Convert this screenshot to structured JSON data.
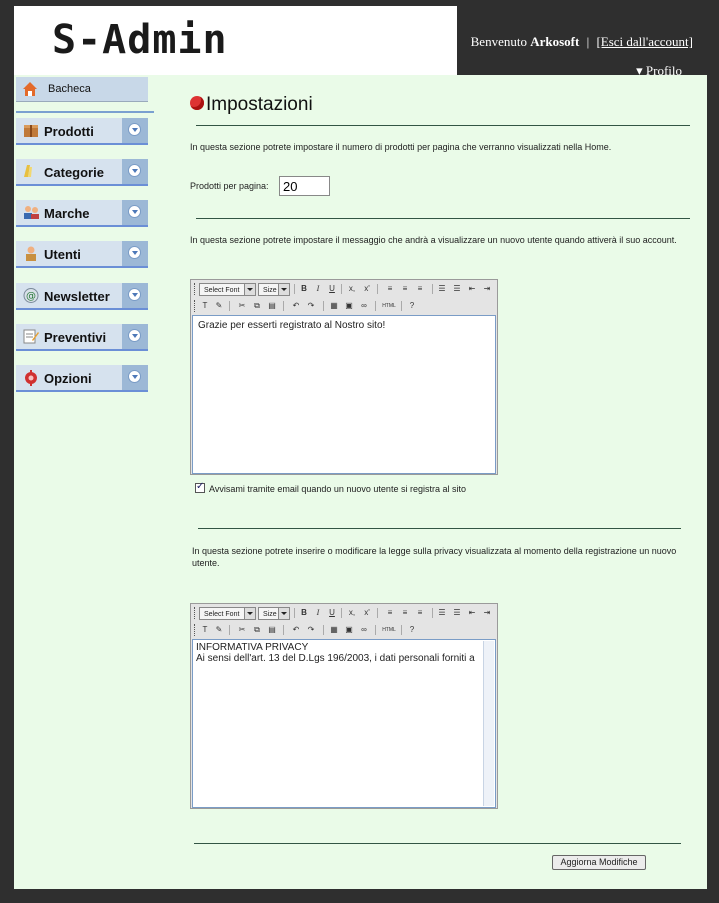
{
  "header": {
    "logo_text": "S-Admin",
    "welcome_prefix": "Benvenuto",
    "username": "Arkosoft",
    "separator": "|",
    "logout": "[Esci dall'account]",
    "profile": "▾ Profilo"
  },
  "sidebar": {
    "home": {
      "label": "Bacheca",
      "icon": "home-icon"
    },
    "items": [
      {
        "label": "Prodotti",
        "icon": "box-icon"
      },
      {
        "label": "Categorie",
        "icon": "folder-icon"
      },
      {
        "label": "Marche",
        "icon": "users-icon"
      },
      {
        "label": "Utenti",
        "icon": "user-icon"
      },
      {
        "label": "Newsletter",
        "icon": "email-icon"
      },
      {
        "label": "Preventivi",
        "icon": "notepad-icon"
      },
      {
        "label": "Opzioni",
        "icon": "gear-icon"
      }
    ]
  },
  "main": {
    "title": "Impostazioni",
    "section1": {
      "description": "In questa sezione potrete impostare il numero di prodotti per pagina che verranno visualizzati nella Home.",
      "label": "Prodotti per pagina:",
      "value": "20"
    },
    "section2": {
      "description": "In questa sezione potrete impostare il messaggio che andrà a visualizzare un nuovo utente quando attiverà il suo account.",
      "editor_text": "Grazie per esserti registrato al Nostro sito!",
      "checkbox_label": "Avvisami tramite email quando un nuovo utente si registra al sito",
      "checkbox_checked": true
    },
    "section3": {
      "description": "In questa sezione potrete inserire o modificare la legge sulla privacy visualizzata al momento della registrazione un nuovo utente.",
      "editor_line1": "INFORMATIVA PRIVACY",
      "editor_line2": "Ai sensi dell'art. 13 del D.Lgs 196/2003, i dati personali forniti a"
    },
    "toolbar": {
      "font_select": "Select Font",
      "size_select": "Size",
      "bold": "B",
      "italic": "I",
      "underline": "U",
      "subscript": "x,",
      "superscript": "x'",
      "html": "HTML",
      "help": "?"
    },
    "submit_label": "Aggiorna Modifiche"
  },
  "colors": {
    "background": "#2f2f2f",
    "content_bg": "#eafbe8",
    "nav_bg": "#d6e2ee",
    "nav_accent": "#6b8fd6"
  }
}
